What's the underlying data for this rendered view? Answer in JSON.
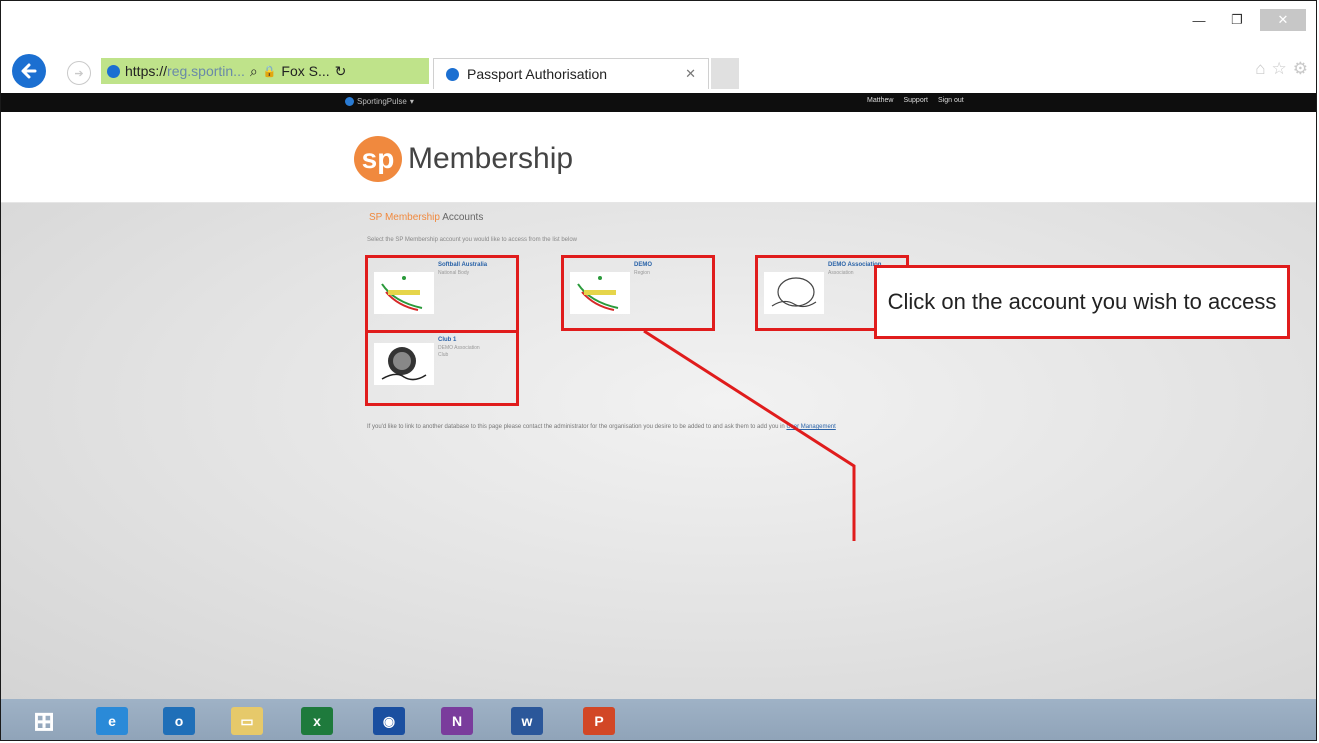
{
  "window": {
    "minimize_glyph": "—",
    "restore_glyph": "❐",
    "close_glyph": "✕"
  },
  "browser": {
    "address_protocol": "https://",
    "address_host": "reg.sportin...",
    "search_glyph": "⌕",
    "lock_glyph": "🔒",
    "site_identity": "Fox S...",
    "refresh_glyph": "↻",
    "tab_title": "Passport Authorisation",
    "tab_close_glyph": "✕",
    "icons": [
      "home-icon",
      "star-icon",
      "gear-icon"
    ]
  },
  "site_nav": {
    "brand": "SportingPulse",
    "links": [
      "Matthew",
      "Support",
      "Sign out"
    ]
  },
  "header": {
    "logo_letters": "sp",
    "logo_word": "Membership"
  },
  "content": {
    "title_prefix": "SP Membership",
    "title_suffix": "Accounts",
    "subtitle": "Select the SP Membership account you would like to access from the list below",
    "accounts": [
      {
        "name": "Softball Australia",
        "sub": "National Body",
        "sub2": ""
      },
      {
        "name": "DEMO",
        "sub": "Region",
        "sub2": ""
      },
      {
        "name": "DEMO Association",
        "sub": "Association",
        "sub2": ""
      },
      {
        "name": "Club 1",
        "sub": "DEMO Association",
        "sub2": "Club"
      }
    ],
    "footer_text": "If you'd like to link to another database to this page please contact the administrator for the organisation you desire to be added to and ask them to add you in",
    "footer_link": "User Management",
    "callout": "Click on the account you wish to access"
  },
  "taskbar": {
    "apps": [
      {
        "icon": "windows-start-icon",
        "label": "⊞",
        "color": "#ffffff"
      },
      {
        "icon": "internet-explorer-icon",
        "label": "e",
        "color": "#2a8ad8"
      },
      {
        "icon": "outlook-icon",
        "label": "o",
        "color": "#1f6fb8"
      },
      {
        "icon": "file-explorer-icon",
        "label": "▭",
        "color": "#e6c96a"
      },
      {
        "icon": "excel-icon",
        "label": "x",
        "color": "#1e7a3c"
      },
      {
        "icon": "browser-app-icon",
        "label": "◉",
        "color": "#1a4fa0"
      },
      {
        "icon": "onenote-icon",
        "label": "N",
        "color": "#7a3c9c"
      },
      {
        "icon": "word-icon",
        "label": "w",
        "color": "#2b579a"
      },
      {
        "icon": "powerpoint-icon",
        "label": "P",
        "color": "#d24726"
      }
    ]
  }
}
